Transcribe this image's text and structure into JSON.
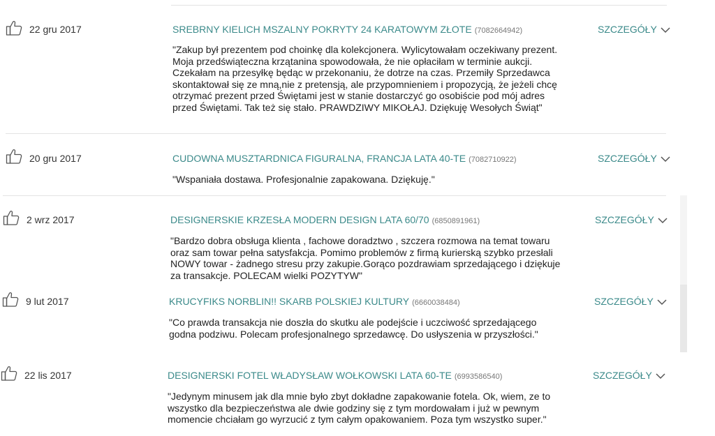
{
  "feedback": [
    {
      "date": "22 gru 2017",
      "title": "SREBRNY KIELICH MSZALNY POKRYTY 24 KARATOWYM ZŁOTE",
      "id": "(7082664942)",
      "details_label": "SZCZEGÓŁY",
      "comment": "\"Zakup był prezentem pod choinkę dla kolekcjonera. Wylicytowałam oczekiwany prezent.\nMoja przedświąteczna krzątanina spowodowała, że nie opłaciłam w terminie aukcji.\nCzekałam na przesyłkę będąc w przekonaniu, że dotrze na czas. Przemiły Sprzedawca\nskontaktował się ze mną,nie z pretensją, ale przypomnieniem i propozycją, że jeżeli chcę\notrzymać prezent przed Świętami jest w stanie dostarczyć go osobiście pod mój adres\nprzed Świętami. Tak też się stało. PRAWDZIWY MIKOŁAJ. Dziękuję Wesołych Świąt\""
    },
    {
      "date": "20 gru 2017",
      "title": "CUDOWNA MUSZTARDNICA FIGURALNA, FRANCJA LATA 40-TE",
      "id": "(7082710922)",
      "details_label": "SZCZEGÓŁY",
      "comment": "\"Wspaniała dostawa. Profesjonalnie zapakowana. Dziękuję.\""
    },
    {
      "date": "2 wrz 2017",
      "title": "DESIGNERSKIE KRZESŁA MODERN DESIGN LATA 60/70",
      "id": "(6850891961)",
      "details_label": "SZCZEGÓŁY",
      "comment": "\"Bardzo dobra obsługa klienta , fachowe doradztwo , szczera rozmowa na temat towaru\noraz sam towar pełna satysfakcja. Pomimo problemów z firmą kurierską szybko przesłali\nNOWY towar - żadnego stresu przy zakupie.Gorąco pozdrawiam sprzedającego i dziękuje\nza transakcje. POLECAM wielki POZYTYW\""
    },
    {
      "date": "9 lut 2017",
      "title": "KRUCYFIKS NORBLIN!! SKARB POLSKIEJ KULTURY",
      "id": "(6660038484)",
      "details_label": "SZCZEGÓŁY",
      "comment": "\"Co prawda transakcja nie doszła do skutku ale podejście i uczciwość sprzedającego\ngodna podziwu. Polecam profesjonalnego sprzedawcę. Do usłyszenia w przyszłości.\""
    },
    {
      "date": "22 lis 2017",
      "title": "DESIGNERSKI FOTEL WŁADYSŁAW WOŁKOWSKI LATA 60-TE",
      "id": "(6993586540)",
      "details_label": "SZCZEGÓŁY",
      "comment": "\"Jedynym minusem jak dla mnie było zbyt dokładne zapakowanie fotela. Ok, wiem, ze to\nwszystko dla bezpieczeństwa ale dwie godziny się z tym mordowałam i już w pewnym\nmomencie chciałam go wyrzucić z tym całym opakowaniem. Poza tym wszystko super.\""
    }
  ],
  "icons": {
    "rating": "thumbs-up-icon",
    "expand": "chevron-down-icon"
  },
  "colors": {
    "accent": "#3b8a8a",
    "text": "#222222",
    "muted": "#777777",
    "divider": "#e3e3e3"
  }
}
